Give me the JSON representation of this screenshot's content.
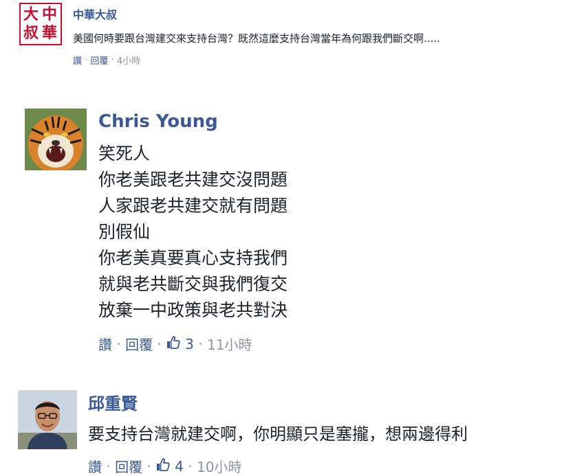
{
  "comments": [
    {
      "author": "中華大叔",
      "avatar": "seal-logo-avatar",
      "avatar_text": "大中叔華",
      "text": "美國何時要跟台灣建交來支持台灣？既然這麼支持台灣當年為何跟我們斷交啊.....",
      "actions": {
        "like": "讚",
        "reply": "回覆",
        "time": "4小時"
      }
    },
    {
      "author": "Chris Young",
      "avatar": "tiger-avatar",
      "lines": [
        "笑死人",
        "你老美跟老共建交沒問題",
        "人家跟老共建交就有問題",
        "別假仙",
        "你老美真要真心支持我們",
        "就與老共斷交與我們復交",
        "放棄一中政策與老共對決"
      ],
      "actions": {
        "like": "讚",
        "reply": "回覆",
        "count": "3",
        "time": "11小時"
      }
    },
    {
      "author": "邱重賢",
      "avatar": "man-glasses-avatar",
      "text": "要支持台灣就建交啊，你明顯只是塞攏，想兩邊得利",
      "actions": {
        "like": "讚",
        "reply": "回覆",
        "count": "4",
        "time": "10小時"
      }
    }
  ],
  "colors": {
    "link": "#385898",
    "meta": "#90949c",
    "text": "#1d2129",
    "seal": "#c8102e"
  }
}
